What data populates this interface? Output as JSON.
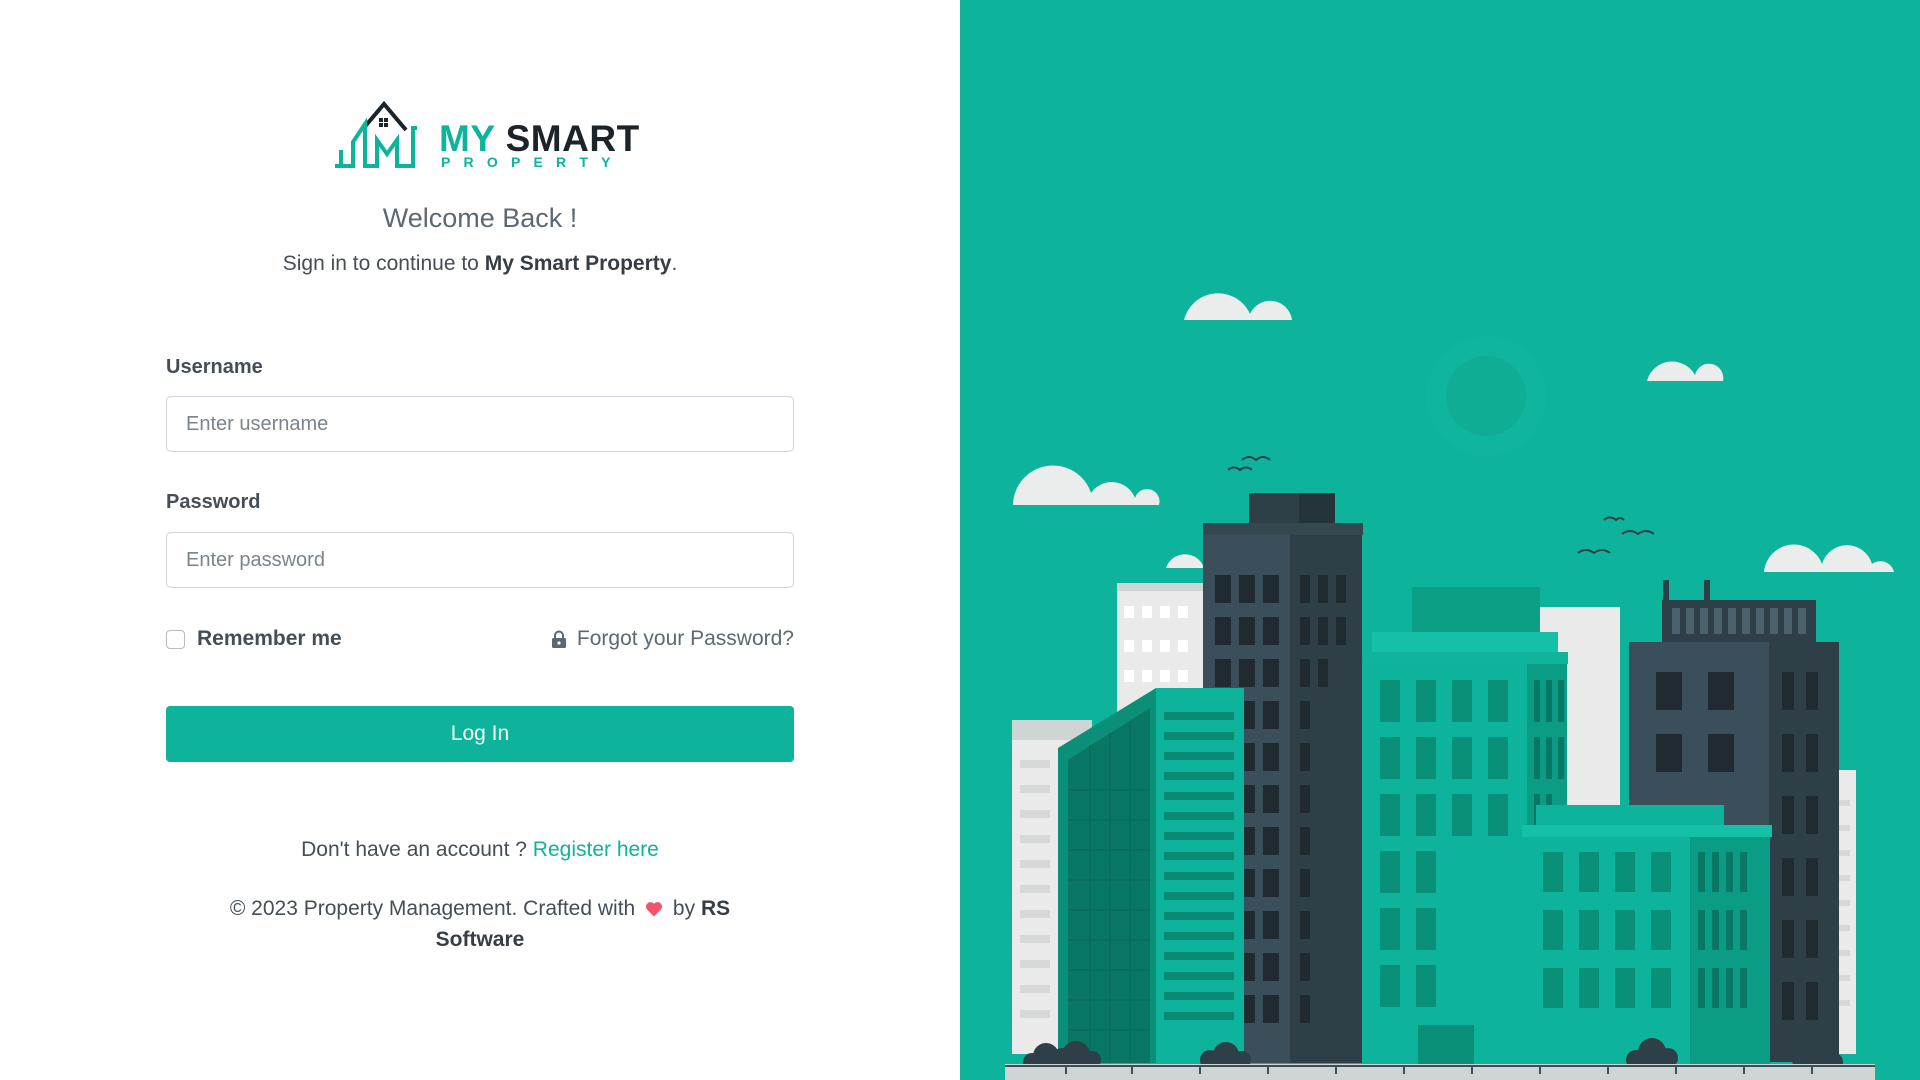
{
  "brand": {
    "logo_main_1": "MY",
    "logo_main_2": "SMART",
    "logo_sub": "PROPERTY",
    "name": "My Smart Property"
  },
  "header": {
    "welcome": "Welcome Back !",
    "subtitle_prefix": "Sign in to continue to ",
    "subtitle_suffix": "."
  },
  "form": {
    "username_label": "Username",
    "username_placeholder": "Enter username",
    "username_value": "",
    "password_label": "Password",
    "password_placeholder": "Enter password",
    "password_value": "",
    "remember_label": "Remember me",
    "remember_checked": false,
    "forgot_label": "Forgot your Password?",
    "login_label": "Log In"
  },
  "register": {
    "prompt": "Don't have an account ? ",
    "link": "Register here"
  },
  "footer": {
    "prefix": "© 2023 Property Management. Crafted with",
    "by": "by",
    "company": "RS Software"
  },
  "colors": {
    "accent": "#0db39a",
    "text_dark": "#454e57",
    "heart": "#f1556c"
  },
  "icons": {
    "forgot": "lock-icon",
    "footer": "heart-icon"
  }
}
